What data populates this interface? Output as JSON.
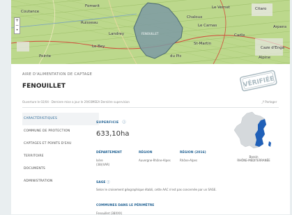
{
  "map": {
    "labels": [
      "Coutance",
      "Fomerit",
      "Landrey",
      "Ruisseau",
      "Le Bey",
      "FENOUILLET",
      "Chaloux",
      "Le Carnas",
      "Le Vernet",
      "St-Martin",
      "Cadix",
      "Citaro",
      "Caze d'Enga",
      "Pointe",
      "du Pic",
      "Alpine",
      "Arpens"
    ],
    "zoom_in": "+",
    "zoom_out": "−"
  },
  "header": {
    "subtitle": "AIRE D'ALIMENTATION DE CAPTAGE",
    "title": "FENOUILLET",
    "info_left": "Ouverture le 02/04 · Derniere mise a jour le 29/03",
    "info_mid": "MEEA Dernière supervision",
    "info_right": "Partager",
    "stamp_text": "VÉRIFIÉE"
  },
  "sidebar": {
    "items": [
      {
        "label": "CARACTÉRISTIQUES",
        "active": true
      },
      {
        "label": "COMMUNE DE PROTECTION",
        "active": false
      },
      {
        "label": "CAPTAGES ET POINTS D'EAU",
        "active": false
      },
      {
        "label": "TERRITOIRE",
        "active": false
      },
      {
        "label": "DOCUMENTS",
        "active": false
      },
      {
        "label": "ADMINISTRATION",
        "active": false
      }
    ]
  },
  "characteristics": {
    "superficie_label": "SUPERFICIE",
    "superficie_value": "633,10ha",
    "departement_label": "DÉPARTEMENT",
    "departement_value_line1": "Isère",
    "departement_value_line2": "(38)(VAR)",
    "region_label": "RÉGION",
    "region_value": "Auvergne-Rhône-Alpes",
    "region2016_label": "RÉGION (2016)",
    "region2016_value": "Rhône-Alpes",
    "sage_label": "SAGE",
    "sage_text": "Selon le croisement géographique établi, cette AAC n'est pas concernée par un SAGE.",
    "communes_label": "COMMUNES DANS LE PÉRIMÈTRE",
    "communes_value": "Fenouillet (38XXX)"
  },
  "basin": {
    "line1": "Bassin",
    "line2": "RHÔNE-MÉDITERRANÉE"
  },
  "colors": {
    "accent": "#1e5f91",
    "map_area": "#7c9aa3",
    "basin": "#2060b8",
    "france": "#d5d9dc"
  }
}
